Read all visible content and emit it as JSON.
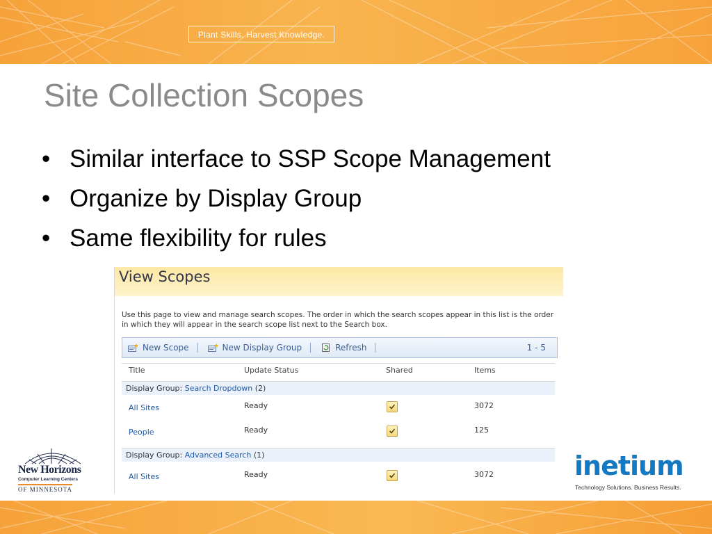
{
  "header": {
    "tagline": "Plant Skills. Harvest Knowledge."
  },
  "slide": {
    "title": "Site Collection Scopes",
    "bullets": [
      "Similar interface to SSP Scope Management",
      "Organize by Display Group",
      "Same flexibility for rules"
    ]
  },
  "screenshot": {
    "title": "View Scopes",
    "description": "Use this page to view and manage search scopes. The order in which the search scopes appear in this list is the order in which they will appear in the search scope list next to the Search box.",
    "toolbar": {
      "new_scope": "New Scope",
      "new_display_group": "New Display Group",
      "refresh": "Refresh",
      "range": "1 - 5"
    },
    "columns": {
      "title": "Title",
      "update_status": "Update Status",
      "shared": "Shared",
      "items": "Items"
    },
    "groups": [
      {
        "prefix": "Display Group:",
        "name": "Search Dropdown",
        "count": "(2)",
        "rows": [
          {
            "title": "All Sites",
            "status": "Ready",
            "items": "3072"
          },
          {
            "title": "People",
            "status": "Ready",
            "items": "125"
          }
        ]
      },
      {
        "prefix": "Display Group:",
        "name": "Advanced Search",
        "count": "(1)",
        "rows": [
          {
            "title": "All Sites",
            "status": "Ready",
            "items": "3072"
          }
        ]
      }
    ]
  },
  "logos": {
    "new_horizons": {
      "name": "New Horizons",
      "subtitle": "Computer Learning Centers",
      "region": "OF MINNESOTA"
    },
    "inetium": {
      "name": "inetium",
      "tagline": "Technology Solutions. Business Results."
    }
  },
  "colors": {
    "accent_orange": "#f7a33c",
    "link_blue": "#1f5aa8",
    "brand_blue": "#1279c2"
  }
}
